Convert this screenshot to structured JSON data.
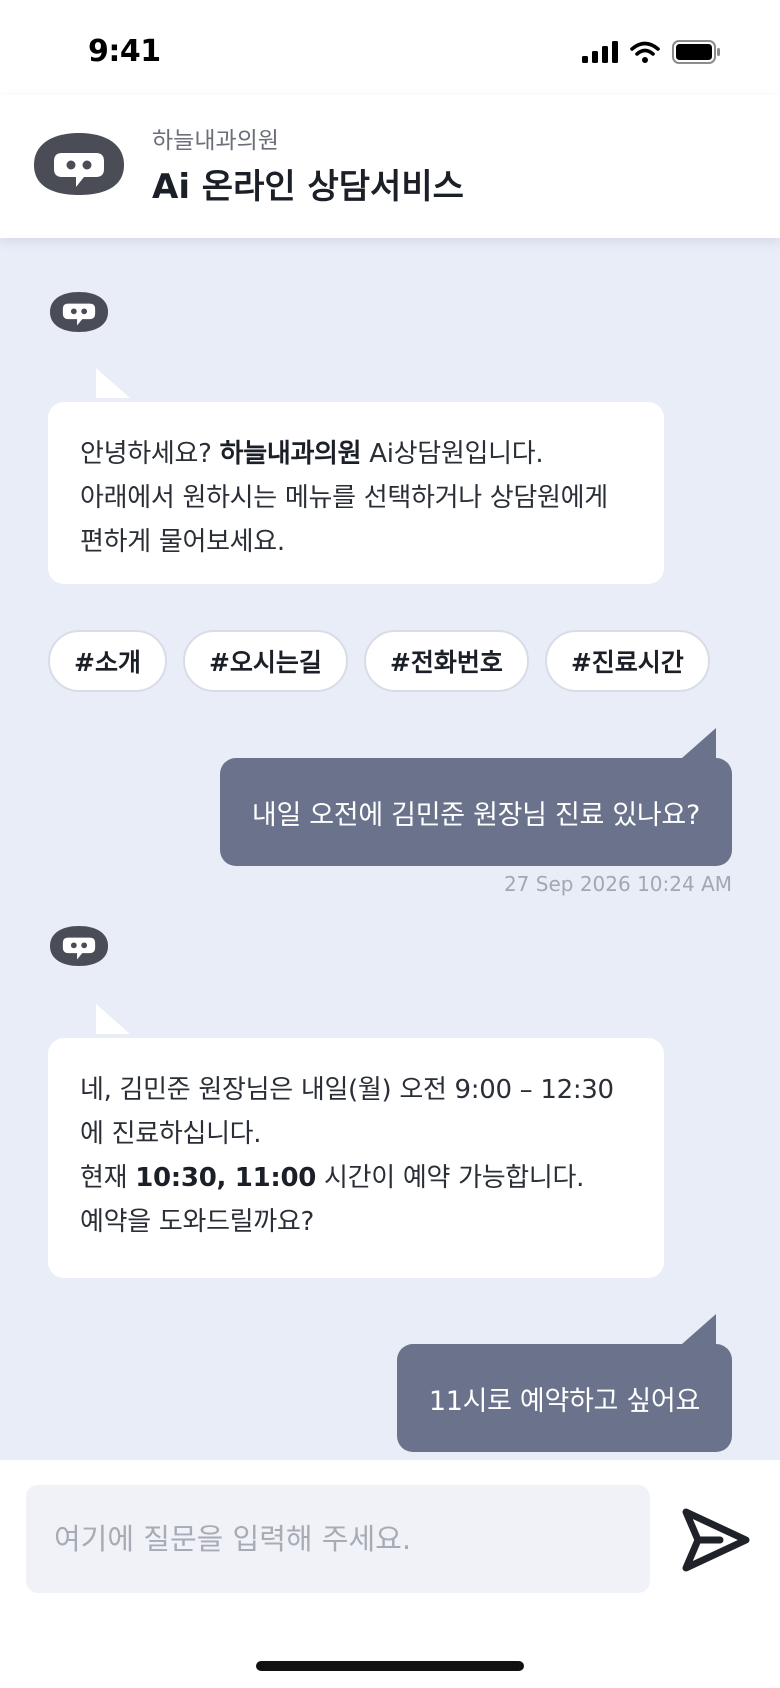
{
  "status_bar": {
    "time": "9:41",
    "icons": [
      "cellular-signal-icon",
      "wifi-icon",
      "battery-icon"
    ]
  },
  "header": {
    "subtitle": "하늘내과의원",
    "title": "Ai 온라인 상담서비스",
    "logo_icon": "robot-chat-icon"
  },
  "colors": {
    "chat_background": "#e9edf8",
    "user_bubble": "#6a738b",
    "bot_bubble": "#ffffff",
    "icon_dark": "#4a4d55"
  },
  "messages": {
    "greeting": {
      "line1_prefix": "안녕하세요? ",
      "line1_clinic": "하늘내과의원",
      "line1_suffix": " Ai상담원입니다.",
      "line2": "아래에서 원하시는 메뉴를 선택하거나 상담원에게 편하게 물어보세요."
    },
    "user_question": {
      "text": "내일 오전에 김민준 원장님 진료 있나요?",
      "timestamp": "27 Sep 2026 10:24 AM"
    },
    "bot_reply": {
      "line1": "네, 김민준 원장님은 내일(월) 오전 9:00 – 12:30에 진료하십니다.",
      "line2_prefix": "현재 ",
      "line2_times": "10:30, 11:00",
      "line2_suffix": " 시간이 예약 가능합니다.",
      "line3": "예약을 도와드릴까요?"
    },
    "user_reply": {
      "text": "11시로 예약하고 싶어요"
    }
  },
  "quick_chips": [
    {
      "label": "#소개"
    },
    {
      "label": "#오시는길"
    },
    {
      "label": "#전화번호"
    },
    {
      "label": "#진료시간"
    }
  ],
  "composer": {
    "placeholder": "여기에 질문을 입력해 주세요.",
    "value": "",
    "send_icon": "send-icon"
  }
}
